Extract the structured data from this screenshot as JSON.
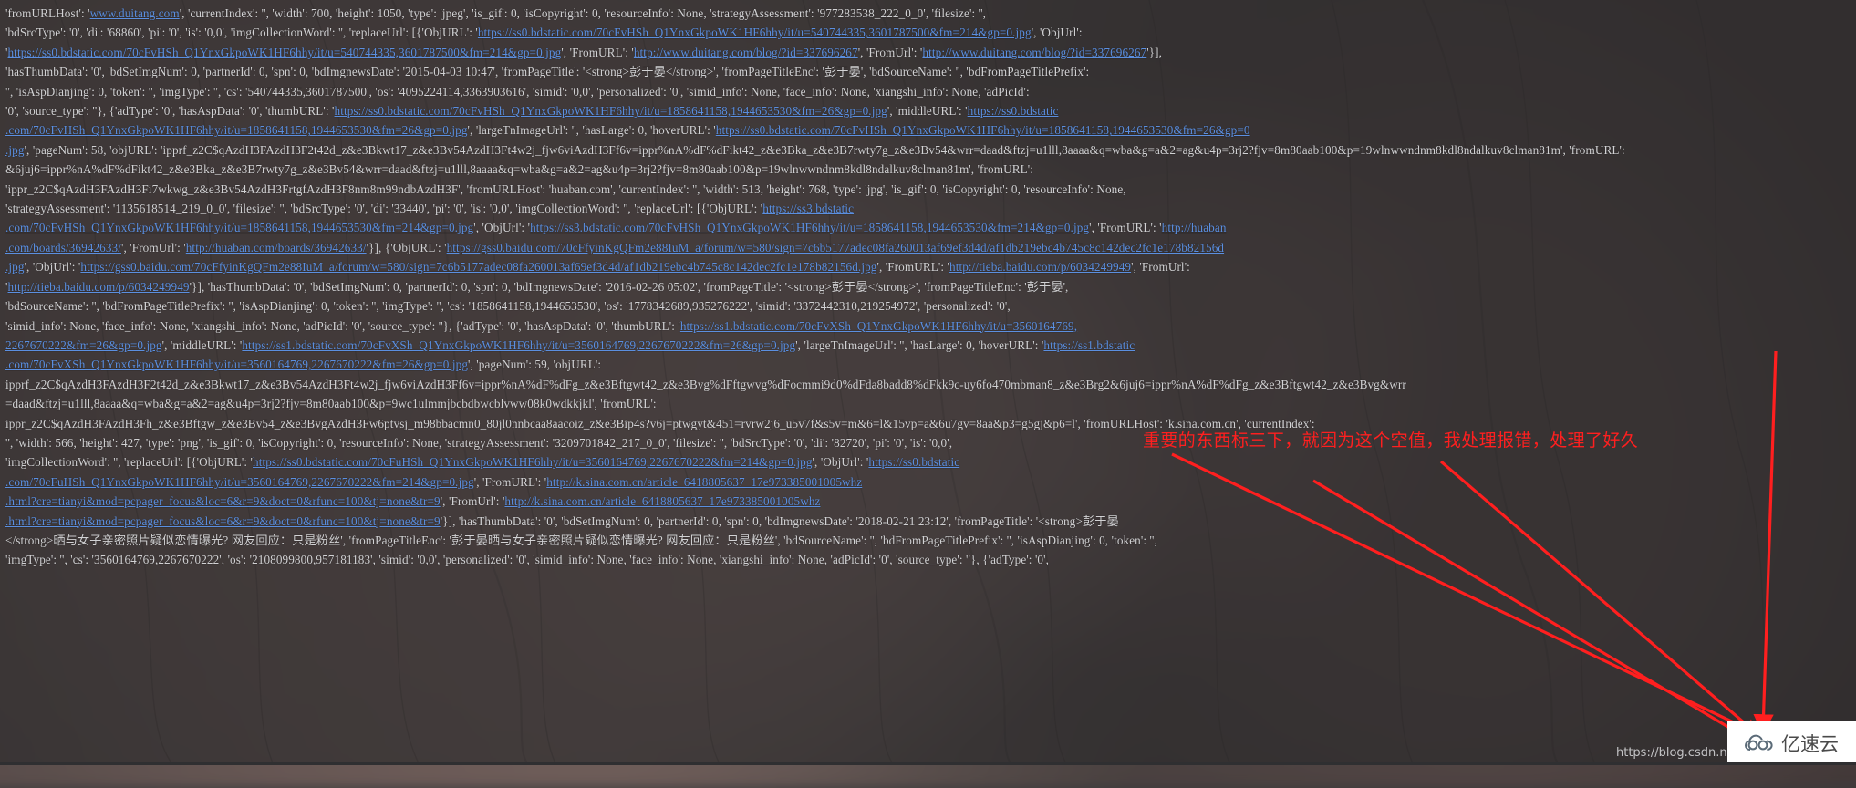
{
  "page": {
    "title": "Baidu image-search result dict dump (annotated screenshot)",
    "background_color": "#3a3a3c",
    "text_color": "#d2d2d4",
    "link_color": "#5b8fe0",
    "annotation_color": "#ff1f1f"
  },
  "annotation": {
    "note_text": "重要的东西标三下，就因为这个空值，我处理报错，处理了好久",
    "arrow_count": 3,
    "highlight_box_label": "red-highlight-box"
  },
  "watermark": {
    "text": "https://blog.csdn.net/q"
  },
  "logo": {
    "mark_name": "cloud-logo-icon",
    "text": "亿速云"
  },
  "console": {
    "lines": [
      [
        {
          "t": "'fromURLHost': '"
        },
        {
          "t": "www.duitang.com",
          "link": true
        },
        {
          "t": "', 'currentIndex': '', 'width': 700, 'height': 1050, 'type': 'jpeg', 'is_gif': 0, 'isCopyright': 0, 'resourceInfo': None, 'strategyAssessment': '977283538_222_0_0', 'filesize': '',"
        }
      ],
      [
        {
          "t": "'bdSrcType': '0', 'di': '68860', 'pi': '0', 'is': '0,0', 'imgCollectionWord': '', 'replaceUrl': [{'ObjURL': '"
        },
        {
          "t": "https://ss0.bdstatic.com/70cFvHSh_Q1YnxGkpoWK1HF6hhy/it/u=540744335,3601787500&fm=214&gp=0.jpg",
          "link": true
        },
        {
          "t": "', 'ObjUrl':"
        }
      ],
      [
        {
          "t": "'"
        },
        {
          "t": "https://ss0.bdstatic.com/70cFvHSh_Q1YnxGkpoWK1HF6hhy/it/u=540744335,3601787500&fm=214&gp=0.jpg",
          "link": true
        },
        {
          "t": "', 'FromURL': '"
        },
        {
          "t": "http://www.duitang.com/blog/?id=337696267",
          "link": true
        },
        {
          "t": "', 'FromUrl': '"
        },
        {
          "t": "http://www.duitang.com/blog/?id=337696267",
          "link": true
        },
        {
          "t": "'}],"
        }
      ],
      [
        {
          "t": "'hasThumbData': '0', 'bdSetImgNum': 0, 'partnerId': 0, 'spn': 0, 'bdImgnewsDate': '2015-04-03 10:47', 'fromPageTitle': '<strong>彭于晏</strong>', 'fromPageTitleEnc': '彭于晏', 'bdSourceName': '', 'bdFromPageTitlePrefix':"
        }
      ],
      [
        {
          "t": "'', 'isAspDianjing': 0, 'token': '', 'imgType': '', 'cs': '540744335,3601787500', 'os': '4095224114,3363903616', 'simid': '0,0', 'personalized': '0', 'simid_info': None, 'face_info': None, 'xiangshi_info': None, 'adPicId':"
        }
      ],
      [
        {
          "t": "'0', 'source_type': ''}, {'adType': '0', 'hasAspData': '0', 'thumbURL': '"
        },
        {
          "t": "https://ss0.bdstatic.com/70cFvHSh_Q1YnxGkpoWK1HF6hhy/it/u=1858641158,1944653530&fm=26&gp=0.jpg",
          "link": true
        },
        {
          "t": "', 'middleURL': '"
        },
        {
          "t": "https://ss0.bdstatic",
          "link": true
        }
      ],
      [
        {
          "t": ".com/70cFvHSh_Q1YnxGkpoWK1HF6hhy/it/u=1858641158,1944653530&fm=26&gp=0.jpg",
          "link": true
        },
        {
          "t": "', 'largeTnImageUrl': '', 'hasLarge': 0, 'hoverURL': '"
        },
        {
          "t": "https://ss0.bdstatic.com/70cFvHSh_Q1YnxGkpoWK1HF6hhy/it/u=1858641158,1944653530&fm=26&gp=0",
          "link": true
        }
      ],
      [
        {
          "t": ".jpg",
          "link": true
        },
        {
          "t": "', 'pageNum': 58, 'objURL': 'ipprf_z2C$qAzdH3FAzdH3F2t42d_z&e3Bkwt17_z&e3Bv54AzdH3Ft4w2j_fjw6viAzdH3Ff6v=ippr%nA%dF%dFikt42_z&e3Bka_z&e3B7rwty7g_z&e3Bv54&wrr=daad&ftzj=u1lll,8aaaa&q=wba&g=a&2=ag&u4p=3rj2?fjv=8m80aab100&p=19wlnwwndnm8kdl8ndalkuv8clman81m', 'fromURL':"
        }
      ],
      [
        {
          "t": "&6juj6=ippr%nA%dF%dFikt42_z&e3Bka_z&e3B7rwty7g_z&e3Bv54&wrr=daad&ftzj=u1lll,8aaaa&q=wba&g=a&2=ag&u4p=3rj2?fjv=8m80aab100&p=19wlnwwndnm8kdl8ndalkuv8clman81m', 'fromURL':"
        }
      ],
      [
        {
          "t": "'ippr_z2C$qAzdH3FAzdH3Fi7wkwg_z&e3Bv54AzdH3FrtgfAzdH3F8nm8m99ndbAzdH3F', 'fromURLHost': 'huaban.com', 'currentIndex': '', 'width': 513, 'height': 768, 'type': 'jpg', 'is_gif': 0, 'isCopyright': 0, 'resourceInfo': None,"
        }
      ],
      [
        {
          "t": "'strategyAssessment': '1135618514_219_0_0', 'filesize': '', 'bdSrcType': '0', 'di': '33440', 'pi': '0', 'is': '0,0', 'imgCollectionWord': '', 'replaceUrl': [{'ObjURL': '"
        },
        {
          "t": "https://ss3.bdstatic",
          "link": true
        }
      ],
      [
        {
          "t": ".com/70cFvHSh_Q1YnxGkpoWK1HF6hhy/it/u=1858641158,1944653530&fm=214&gp=0.jpg",
          "link": true
        },
        {
          "t": "', 'ObjUrl': '"
        },
        {
          "t": "https://ss3.bdstatic.com/70cFvHSh_Q1YnxGkpoWK1HF6hhy/it/u=1858641158,1944653530&fm=214&gp=0.jpg",
          "link": true
        },
        {
          "t": "', 'FromURL': '"
        },
        {
          "t": "http://huaban",
          "link": true
        }
      ],
      [
        {
          "t": ".com/boards/36942633/",
          "link": true
        },
        {
          "t": "', 'FromUrl': '"
        },
        {
          "t": "http://huaban.com/boards/36942633/",
          "link": true
        },
        {
          "t": "'}], {'ObjURL': '"
        },
        {
          "t": "https://gss0.baidu.com/70cFfyinKgQFm2e88IuM_a/forum/w=580/sign=7c6b5177adec08fa260013af69ef3d4d/af1db219ebc4b745c8c142dec2fc1e178b82156d",
          "link": true
        }
      ],
      [
        {
          "t": ".jpg",
          "link": true
        },
        {
          "t": "', 'ObjUrl': '"
        },
        {
          "t": "https://gss0.baidu.com/70cFfyinKgQFm2e88IuM_a/forum/w=580/sign=7c6b5177adec08fa260013af69ef3d4d/af1db219ebc4b745c8c142dec2fc1e178b82156d.jpg",
          "link": true
        },
        {
          "t": "', 'FromURL': '"
        },
        {
          "t": "http://tieba.baidu.com/p/6034249949",
          "link": true
        },
        {
          "t": "', 'FromUrl':"
        }
      ],
      [
        {
          "t": "'"
        },
        {
          "t": "http://tieba.baidu.com/p/6034249949",
          "link": true
        },
        {
          "t": "'}], 'hasThumbData': '0', 'bdSetImgNum': 0, 'partnerId': 0, 'spn': 0, 'bdImgnewsDate': '2016-02-26 05:02', 'fromPageTitle': '<strong>彭于晏</strong>', 'fromPageTitleEnc': '彭于晏',"
        }
      ],
      [
        {
          "t": "'bdSourceName': '', 'bdFromPageTitlePrefix': '', 'isAspDianjing': 0, 'token': '', 'imgType': '', 'cs': '1858641158,1944653530', 'os': '1778342689,935276222', 'simid': '3372442310,219254972', 'personalized': '0',"
        }
      ],
      [
        {
          "t": "'simid_info': None, 'face_info': None, 'xiangshi_info': None, 'adPicId': '0', 'source_type': ''}, {'adType': '0', 'hasAspData': '0', 'thumbURL': '"
        },
        {
          "t": "https://ss1.bdstatic.com/70cFvXSh_Q1YnxGkpoWK1HF6hhy/it/u=3560164769,",
          "link": true
        }
      ],
      [
        {
          "t": "2267670222&fm=26&gp=0.jpg",
          "link": true
        },
        {
          "t": "', 'middleURL': '"
        },
        {
          "t": "https://ss1.bdstatic.com/70cFvXSh_Q1YnxGkpoWK1HF6hhy/it/u=3560164769,2267670222&fm=26&gp=0.jpg",
          "link": true
        },
        {
          "t": "', 'largeTnImageUrl': '', 'hasLarge': 0, 'hoverURL': '"
        },
        {
          "t": "https://ss1.bdstatic",
          "link": true
        }
      ],
      [
        {
          "t": ".com/70cFvXSh_Q1YnxGkpoWK1HF6hhy/it/u=3560164769,2267670222&fm=26&gp=0.jpg",
          "link": true
        },
        {
          "t": "', 'pageNum': 59, 'objURL':"
        }
      ],
      [
        {
          "t": "ipprf_z2C$qAzdH3FAzdH3F2t42d_z&e3Bkwt17_z&e3Bv54AzdH3Ft4w2j_fjw6viAzdH3Ff6v=ippr%nA%dF%dFg_z&e3Bftgwt42_z&e3Bvg%dFftgwvg%dFocmmi9d0%dFda8badd8%dFkk9c-uy6fo470mbman8_z&e3Brg2&6juj6=ippr%nA%dF%dFg_z&e3Bftgwt42_z&e3Bvg&wrr"
        }
      ],
      [
        {
          "t": "=daad&ftzj=u1lll,8aaaa&q=wba&g=a&2=ag&u4p=3rj2?fjv=8m80aab100&p=9wc1ulmmjbcbdbwcblvww08k0wdkkjkl', 'fromURL':"
        }
      ],
      [
        {
          "t": "ippr_z2C$qAzdH3FAzdH3Fh_z&e3Bftgw_z&e3Bv54_z&e3BvgAzdH3Fw6ptvsj_m98bbacmn0_80jl0nnbcaa8aacoiz_z&e3Bip4s?v6j=ptwgyt&451=rvrw2j6_u5v7f&s5v=m&6=l&15vp=a&6u7gv=8aa&p3=g5gj&p6=l', 'fromURLHost': 'k.sina.com.cn', 'currentIndex':"
        }
      ],
      [
        {
          "t": "'', 'width': 566, 'height': 427, 'type': 'png', 'is_gif': 0, 'isCopyright': 0, 'resourceInfo': None, 'strategyAssessment': '3209701842_217_0_0', 'filesize': '', 'bdSrcType': '0', 'di': '82720', 'pi': '0', 'is': '0,0',"
        }
      ],
      [
        {
          "t": "'imgCollectionWord': '', 'replaceUrl': [{'ObjURL': '"
        },
        {
          "t": "https://ss0.bdstatic.com/70cFuHSh_Q1YnxGkpoWK1HF6hhy/it/u=3560164769,2267670222&fm=214&gp=0.jpg",
          "link": true
        },
        {
          "t": "', 'ObjUrl': '"
        },
        {
          "t": "https://ss0.bdstatic",
          "link": true
        }
      ],
      [
        {
          "t": ".com/70cFuHSh_Q1YnxGkpoWK1HF6hhy/it/u=3560164769,2267670222&fm=214&gp=0.jpg",
          "link": true
        },
        {
          "t": "', 'FromURL': '"
        },
        {
          "t": "http://k.sina.com.cn/article_6418805637_17e973385001005whz",
          "link": true
        }
      ],
      [
        {
          "t": ".html?cre=tianyi&mod=pcpager_focus&loc=6&r=9&doct=0&rfunc=100&tj=none&tr=9",
          "link": true
        },
        {
          "t": "', 'FromUrl': '"
        },
        {
          "t": "http://k.sina.com.cn/article_6418805637_17e973385001005whz",
          "link": true
        }
      ],
      [
        {
          "t": ".html?cre=tianyi&mod=pcpager_focus&loc=6&r=9&doct=0&rfunc=100&tj=none&tr=9",
          "link": true
        },
        {
          "t": "'}], 'hasThumbData': '0', 'bdSetImgNum': 0, 'partnerId': 0, 'spn': 0, 'bdImgnewsDate': '2018-02-21 23:12', 'fromPageTitle': '<strong>彭于晏"
        }
      ],
      [
        {
          "t": "</strong>晒与女子亲密照片疑似恋情曝光? 网友回应：只是粉丝', 'fromPageTitleEnc': '彭于晏晒与女子亲密照片疑似恋情曝光? 网友回应：只是粉丝', 'bdSourceName': '', 'bdFromPageTitlePrefix': '', 'isAspDianjing': 0, 'token': '',"
        }
      ],
      [
        {
          "t": "'imgType': '', 'cs': '3560164769,2267670222', 'os': '2108099800,957181183', 'simid': '0,0', 'personalized': '0', 'simid_info': None, 'face_info': None, 'xiangshi_info': None, 'adPicId': '0', 'source_type': ''}, {'adType': '0',"
        }
      ]
    ]
  }
}
